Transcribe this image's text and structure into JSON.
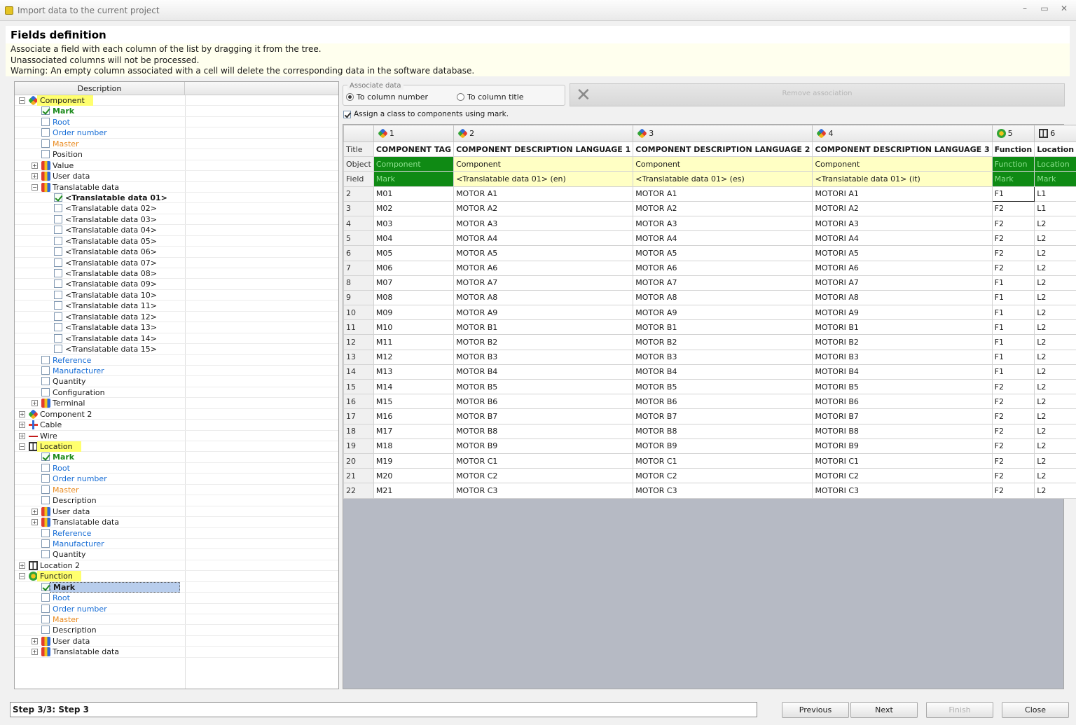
{
  "window": {
    "title": "Import data to the current project",
    "controls": [
      "–",
      "▭",
      "✕"
    ]
  },
  "header": {
    "title": "Fields definition",
    "lines": [
      "Associate a field with each column of the list by dragging it from the tree.",
      "Unassociated columns will not be processed.",
      "Warning: An empty column associated with a cell will delete the corresponding data in the software database."
    ]
  },
  "tree": {
    "column_header": "Description",
    "rows": [
      {
        "label": "Component",
        "level": 0,
        "expander": "−",
        "icon": "component-icon",
        "style": "",
        "highlight": true
      },
      {
        "label": "Mark",
        "level": 1,
        "check": true,
        "style": "green"
      },
      {
        "label": "Root",
        "level": 1,
        "check": false,
        "style": "blue"
      },
      {
        "label": "Order number",
        "level": 1,
        "check": false,
        "style": "blue"
      },
      {
        "label": "Master",
        "level": 1,
        "check": false,
        "style": "orange"
      },
      {
        "label": "Position",
        "level": 1,
        "check": false,
        "style": ""
      },
      {
        "label": "Value",
        "level": 1,
        "expander": "+",
        "icon": "data-icon",
        "style": ""
      },
      {
        "label": "User data",
        "level": 1,
        "expander": "+",
        "icon": "data-icon",
        "style": ""
      },
      {
        "label": "Translatable data",
        "level": 1,
        "expander": "−",
        "icon": "data-icon",
        "style": ""
      },
      {
        "label": "<Translatable data 01>",
        "level": 2,
        "check": true,
        "style": "bold"
      },
      {
        "label": "<Translatable data 02>",
        "level": 2,
        "check": false,
        "style": ""
      },
      {
        "label": "<Translatable data 03>",
        "level": 2,
        "check": false,
        "style": ""
      },
      {
        "label": "<Translatable data 04>",
        "level": 2,
        "check": false,
        "style": ""
      },
      {
        "label": "<Translatable data 05>",
        "level": 2,
        "check": false,
        "style": ""
      },
      {
        "label": "<Translatable data 06>",
        "level": 2,
        "check": false,
        "style": ""
      },
      {
        "label": "<Translatable data 07>",
        "level": 2,
        "check": false,
        "style": ""
      },
      {
        "label": "<Translatable data 08>",
        "level": 2,
        "check": false,
        "style": ""
      },
      {
        "label": "<Translatable data 09>",
        "level": 2,
        "check": false,
        "style": ""
      },
      {
        "label": "<Translatable data 10>",
        "level": 2,
        "check": false,
        "style": ""
      },
      {
        "label": "<Translatable data 11>",
        "level": 2,
        "check": false,
        "style": ""
      },
      {
        "label": "<Translatable data 12>",
        "level": 2,
        "check": false,
        "style": ""
      },
      {
        "label": "<Translatable data 13>",
        "level": 2,
        "check": false,
        "style": ""
      },
      {
        "label": "<Translatable data 14>",
        "level": 2,
        "check": false,
        "style": ""
      },
      {
        "label": "<Translatable data 15>",
        "level": 2,
        "check": false,
        "style": ""
      },
      {
        "label": "Reference",
        "level": 1,
        "check": false,
        "style": "blue"
      },
      {
        "label": "Manufacturer",
        "level": 1,
        "check": false,
        "style": "blue"
      },
      {
        "label": "Quantity",
        "level": 1,
        "check": false,
        "style": ""
      },
      {
        "label": "Configuration",
        "level": 1,
        "check": false,
        "style": ""
      },
      {
        "label": "Terminal",
        "level": 1,
        "expander": "+",
        "icon": "data-icon",
        "style": ""
      },
      {
        "label": "Component 2",
        "level": 0,
        "expander": "+",
        "icon": "component-icon",
        "style": ""
      },
      {
        "label": "Cable",
        "level": 0,
        "expander": "+",
        "icon": "cable-icon",
        "style": ""
      },
      {
        "label": "Wire",
        "level": 0,
        "expander": "+",
        "icon": "wire-icon",
        "style": ""
      },
      {
        "label": "Location",
        "level": 0,
        "expander": "−",
        "icon": "location-icon",
        "style": "",
        "highlight": true
      },
      {
        "label": "Mark",
        "level": 1,
        "check": true,
        "style": "green"
      },
      {
        "label": "Root",
        "level": 1,
        "check": false,
        "style": "blue"
      },
      {
        "label": "Order number",
        "level": 1,
        "check": false,
        "style": "blue"
      },
      {
        "label": "Master",
        "level": 1,
        "check": false,
        "style": "orange"
      },
      {
        "label": "Description",
        "level": 1,
        "check": false,
        "style": ""
      },
      {
        "label": "User data",
        "level": 1,
        "expander": "+",
        "icon": "data-icon",
        "style": ""
      },
      {
        "label": "Translatable data",
        "level": 1,
        "expander": "+",
        "icon": "data-icon",
        "style": ""
      },
      {
        "label": "Reference",
        "level": 1,
        "check": false,
        "style": "blue"
      },
      {
        "label": "Manufacturer",
        "level": 1,
        "check": false,
        "style": "blue"
      },
      {
        "label": "Quantity",
        "level": 1,
        "check": false,
        "style": ""
      },
      {
        "label": "Location 2",
        "level": 0,
        "expander": "+",
        "icon": "location-icon",
        "style": ""
      },
      {
        "label": "Function",
        "level": 0,
        "expander": "−",
        "icon": "function-icon",
        "style": "",
        "highlight": true
      },
      {
        "label": "Mark",
        "level": 1,
        "check": true,
        "style": "selected"
      },
      {
        "label": "Root",
        "level": 1,
        "check": false,
        "style": "blue"
      },
      {
        "label": "Order number",
        "level": 1,
        "check": false,
        "style": "blue"
      },
      {
        "label": "Master",
        "level": 1,
        "check": false,
        "style": "orange"
      },
      {
        "label": "Description",
        "level": 1,
        "check": false,
        "style": ""
      },
      {
        "label": "User data",
        "level": 1,
        "expander": "+",
        "icon": "data-icon",
        "style": ""
      },
      {
        "label": "Translatable data",
        "level": 1,
        "expander": "+",
        "icon": "data-icon",
        "style": ""
      }
    ]
  },
  "associate": {
    "legend": "Associate data",
    "option_number": "To column number",
    "option_title": "To column title",
    "selected": "number",
    "remove_label": "Remove association",
    "assign_label": "Assign a class to components using mark.",
    "assign_checked": true
  },
  "grid": {
    "columns": [
      {
        "num": "",
        "icon": ""
      },
      {
        "num": "1",
        "icon": "component-icon"
      },
      {
        "num": "2",
        "icon": "component-icon"
      },
      {
        "num": "3",
        "icon": "component-icon"
      },
      {
        "num": "4",
        "icon": "component-icon"
      },
      {
        "num": "5",
        "icon": "function-icon"
      },
      {
        "num": "6",
        "icon": "location-icon"
      }
    ],
    "title_row": [
      "Title",
      "COMPONENT TAG",
      "COMPONENT DESCRIPTION LANGUAGE 1",
      "COMPONENT DESCRIPTION LANGUAGE 2",
      "COMPONENT DESCRIPTION LANGUAGE 3",
      "Function",
      "Location"
    ],
    "object_row": [
      "Object",
      "Component",
      "Component",
      "Component",
      "Component",
      "Function",
      "Location"
    ],
    "field_row": [
      "Field",
      "Mark",
      "<Translatable data 01> (en)",
      "<Translatable data 01> (es)",
      "<Translatable data 01> (it)",
      "Mark",
      "Mark"
    ],
    "rows": [
      [
        "2",
        "M01",
        "MOTOR A1",
        "MOTOR A1",
        "MOTORI A1",
        "F1",
        "L1"
      ],
      [
        "3",
        "M02",
        "MOTOR A2",
        "MOTOR A2",
        "MOTORI A2",
        "F2",
        "L1"
      ],
      [
        "4",
        "M03",
        "MOTOR A3",
        "MOTOR A3",
        "MOTORI A3",
        "F2",
        "L2"
      ],
      [
        "5",
        "M04",
        "MOTOR A4",
        "MOTOR A4",
        "MOTORI A4",
        "F2",
        "L2"
      ],
      [
        "6",
        "M05",
        "MOTOR A5",
        "MOTOR A5",
        "MOTORI A5",
        "F2",
        "L2"
      ],
      [
        "7",
        "M06",
        "MOTOR A6",
        "MOTOR A6",
        "MOTORI A6",
        "F2",
        "L2"
      ],
      [
        "8",
        "M07",
        "MOTOR A7",
        "MOTOR A7",
        "MOTORI A7",
        "F1",
        "L2"
      ],
      [
        "9",
        "M08",
        "MOTOR A8",
        "MOTOR A8",
        "MOTORI A8",
        "F1",
        "L2"
      ],
      [
        "10",
        "M09",
        "MOTOR A9",
        "MOTOR A9",
        "MOTORI A9",
        "F1",
        "L2"
      ],
      [
        "11",
        "M10",
        "MOTOR B1",
        "MOTOR B1",
        "MOTORI B1",
        "F1",
        "L2"
      ],
      [
        "12",
        "M11",
        "MOTOR B2",
        "MOTOR B2",
        "MOTORI B2",
        "F1",
        "L2"
      ],
      [
        "13",
        "M12",
        "MOTOR B3",
        "MOTOR B3",
        "MOTORI B3",
        "F1",
        "L2"
      ],
      [
        "14",
        "M13",
        "MOTOR B4",
        "MOTOR B4",
        "MOTORI B4",
        "F1",
        "L2"
      ],
      [
        "15",
        "M14",
        "MOTOR B5",
        "MOTOR B5",
        "MOTORI B5",
        "F2",
        "L2"
      ],
      [
        "16",
        "M15",
        "MOTOR B6",
        "MOTOR B6",
        "MOTORI B6",
        "F2",
        "L2"
      ],
      [
        "17",
        "M16",
        "MOTOR B7",
        "MOTOR B7",
        "MOTORI B7",
        "F2",
        "L2"
      ],
      [
        "18",
        "M17",
        "MOTOR B8",
        "MOTOR B8",
        "MOTORI B8",
        "F2",
        "L2"
      ],
      [
        "19",
        "M18",
        "MOTOR B9",
        "MOTOR B9",
        "MOTORI B9",
        "F2",
        "L2"
      ],
      [
        "20",
        "M19",
        "MOTOR C1",
        "MOTOR C1",
        "MOTORI C1",
        "F2",
        "L2"
      ],
      [
        "21",
        "M20",
        "MOTOR C2",
        "MOTOR C2",
        "MOTORI C2",
        "F2",
        "L2"
      ],
      [
        "22",
        "M21",
        "MOTOR C3",
        "MOTOR C3",
        "MOTORI C3",
        "F2",
        "L2"
      ]
    ]
  },
  "footer": {
    "step": "Step 3/3: Step 3",
    "previous": "Previous",
    "next": "Next",
    "finish": "Finish",
    "close": "Close"
  }
}
